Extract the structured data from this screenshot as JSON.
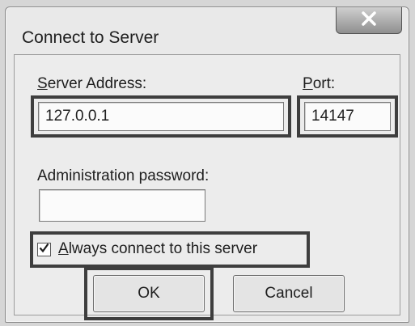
{
  "dialog": {
    "title": "Connect to Server"
  },
  "titlebar": {
    "close_icon": "close-x-icon"
  },
  "server_address": {
    "label_accel": "S",
    "label_rest": "erver Address:",
    "value": "127.0.0.1"
  },
  "port": {
    "label_accel": "P",
    "label_rest": "ort:",
    "value": "14147"
  },
  "admin_password": {
    "label": "Administration password:",
    "value": ""
  },
  "always_connect": {
    "label_accel": "A",
    "label_rest": "lways connect to this server",
    "checked": true
  },
  "buttons": {
    "ok_label": "OK",
    "cancel_label": "Cancel"
  }
}
